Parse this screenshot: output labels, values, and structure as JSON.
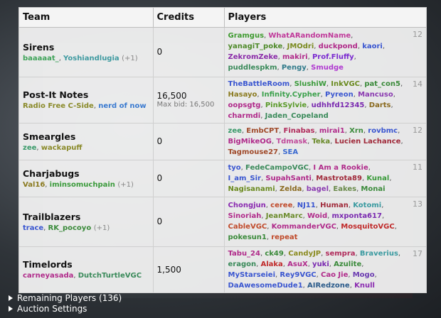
{
  "headers": {
    "team": "Team",
    "credits": "Credits",
    "players": "Players"
  },
  "teams": [
    {
      "name": "Sirens",
      "owners": [
        {
          "n": "baaaaat_",
          "c": "#3fa35a"
        },
        {
          "n": "Yoshiandlugia",
          "c": "#3e9aa0"
        }
      ],
      "extra": "(+1)",
      "credits": "0",
      "maxbid": "",
      "count": "12",
      "players": [
        {
          "n": "Gramgus",
          "c": "#3e9a2f"
        },
        {
          "n": "WhatARandomName",
          "c": "#c0399a"
        },
        {
          "n": "yanagiT_poke",
          "c": "#4f8a2a"
        },
        {
          "n": "JMOdri",
          "c": "#7a8a1f"
        },
        {
          "n": "duckpond",
          "c": "#b02a8a"
        },
        {
          "n": "kaori",
          "c": "#3a56d0"
        },
        {
          "n": "ZekromZeke",
          "c": "#8a2aa8"
        },
        {
          "n": "makiri",
          "c": "#b02a8a"
        },
        {
          "n": "Prof.Fluffy",
          "c": "#7a2ad0"
        },
        {
          "n": "puddlespkm",
          "c": "#3a8a5a"
        },
        {
          "n": "Pengy",
          "c": "#2f7a8a"
        },
        {
          "n": "Smudge",
          "c": "#b03ad0"
        }
      ]
    },
    {
      "name": "Post-It Notes",
      "owners": [
        {
          "n": "Radio Free C-Side",
          "c": "#8a8a2a"
        },
        {
          "n": "nerd of now",
          "c": "#3a7ad0"
        }
      ],
      "extra": "",
      "credits": "16,500",
      "maxbid": "Max bid: 16,500",
      "count": "14",
      "players": [
        {
          "n": "TheBattleRoom",
          "c": "#3a56d0"
        },
        {
          "n": "SlushiW",
          "c": "#3a9a3a"
        },
        {
          "n": "InkVGC",
          "c": "#6a8a1f"
        },
        {
          "n": "pat_con5",
          "c": "#3a8a3a"
        },
        {
          "n": "Hasayo",
          "c": "#8a7a1f"
        },
        {
          "n": "Infinity.Cypher",
          "c": "#3aa04a"
        },
        {
          "n": "Pyreon",
          "c": "#3a56d0"
        },
        {
          "n": "Mancuso",
          "c": "#8a3ab0"
        },
        {
          "n": "oopsgtg",
          "c": "#b02a8a"
        },
        {
          "n": "PinkSylvie",
          "c": "#5a9a2a"
        },
        {
          "n": "udhhfd12345",
          "c": "#7a2ab0"
        },
        {
          "n": "Darts",
          "c": "#8a6a1f"
        },
        {
          "n": "charmdi",
          "c": "#b02a8a"
        },
        {
          "n": "Jaden_Copeland",
          "c": "#3a8a5a"
        }
      ]
    },
    {
      "name": "Smeargles",
      "owners": [
        {
          "n": "zee",
          "c": "#3a9a6a"
        },
        {
          "n": "wackapuff",
          "c": "#8a8a2a"
        }
      ],
      "extra": "",
      "credits": "0",
      "maxbid": "",
      "count": "12",
      "players": [
        {
          "n": "zee",
          "c": "#3a9a6a"
        },
        {
          "n": "EmbCPT",
          "c": "#a04a2a"
        },
        {
          "n": "Finabas",
          "c": "#b02a5a"
        },
        {
          "n": "mirai1",
          "c": "#b02a8a"
        },
        {
          "n": "Xrn",
          "c": "#3a8a3a"
        },
        {
          "n": "rovbmc",
          "c": "#3a56d0"
        },
        {
          "n": "BigMikeOG",
          "c": "#b02a8a"
        },
        {
          "n": "Tdmask",
          "c": "#c04a9a"
        },
        {
          "n": "Teka",
          "c": "#6a8a2a"
        },
        {
          "n": "Lucien Lachance",
          "c": "#a02a3a"
        },
        {
          "n": "Tagmouse27",
          "c": "#a04a2a"
        },
        {
          "n": "SEA",
          "c": "#3a6ad0"
        }
      ]
    },
    {
      "name": "Charjabugs",
      "owners": [
        {
          "n": "Val16",
          "c": "#8a7a1f"
        },
        {
          "n": "iminsomuchpain",
          "c": "#3a9a3a"
        }
      ],
      "extra": "(+1)",
      "credits": "0",
      "maxbid": "",
      "count": "11",
      "players": [
        {
          "n": "tyo",
          "c": "#3a56d0"
        },
        {
          "n": "FedeCampoVGC",
          "c": "#3a8a5a"
        },
        {
          "n": "I Am a Rookie",
          "c": "#b02a8a"
        },
        {
          "n": "I_am_Sir",
          "c": "#3a56d0"
        },
        {
          "n": "SupahSanti",
          "c": "#b02a8a"
        },
        {
          "n": "Mastrota89",
          "c": "#a02a3a"
        },
        {
          "n": "Kunal",
          "c": "#3a9a3a"
        },
        {
          "n": "Nagisanami",
          "c": "#6a8a1f"
        },
        {
          "n": "Zelda",
          "c": "#8a6a1f"
        },
        {
          "n": "bagel",
          "c": "#8a3ab0"
        },
        {
          "n": "Eakes",
          "c": "#6a8a4a"
        },
        {
          "n": "Monai",
          "c": "#3a8a3a"
        }
      ]
    },
    {
      "name": "Trailblazers",
      "owners": [
        {
          "n": "trace",
          "c": "#3a56d0"
        },
        {
          "n": "RK_pocoyo",
          "c": "#3a8a3a"
        }
      ],
      "extra": "(+1)",
      "credits": "0",
      "maxbid": "",
      "count": "13",
      "players": [
        {
          "n": "Chongjun",
          "c": "#8a2ab0"
        },
        {
          "n": "ceree",
          "c": "#c04a2a"
        },
        {
          "n": "NJ11",
          "c": "#3a56d0"
        },
        {
          "n": "Human",
          "c": "#a02a3a"
        },
        {
          "n": "Kotomi",
          "c": "#3a9aa0"
        },
        {
          "n": "Sinoriah",
          "c": "#b02a8a"
        },
        {
          "n": "JeanMarc",
          "c": "#6a8a2a"
        },
        {
          "n": "Woid",
          "c": "#b02a8a"
        },
        {
          "n": "mxponta617",
          "c": "#7a2ab0"
        },
        {
          "n": "CableVGC",
          "c": "#c04a2a"
        },
        {
          "n": "KommanderVGC",
          "c": "#b02a8a"
        },
        {
          "n": "MosquitoVGC",
          "c": "#c02a2a"
        },
        {
          "n": "pokesun1",
          "c": "#3a8a3a"
        },
        {
          "n": "repeat",
          "c": "#c04a2a"
        }
      ]
    },
    {
      "name": "Timelords",
      "owners": [
        {
          "n": "carneyasada",
          "c": "#b02a8a"
        },
        {
          "n": "DutchTurtleVGC",
          "c": "#3a8a5a"
        }
      ],
      "extra": "",
      "credits": "1,500",
      "maxbid": "",
      "count": "17",
      "players": [
        {
          "n": "Tabu_24",
          "c": "#b02a8a"
        },
        {
          "n": "ck49",
          "c": "#3a8a3a"
        },
        {
          "n": "CandyJP",
          "c": "#8a8a1f"
        },
        {
          "n": "sempra",
          "c": "#b02a5a"
        },
        {
          "n": "Braverius",
          "c": "#3a9aa0"
        },
        {
          "n": "eragon",
          "c": "#3a8a5a"
        },
        {
          "n": "Alaka",
          "c": "#c02a2a"
        },
        {
          "n": "AsuX",
          "c": "#b02a8a"
        },
        {
          "n": "yuki",
          "c": "#7a2ab0"
        },
        {
          "n": "Azulite",
          "c": "#3a8a3a"
        },
        {
          "n": "MyStarseiei",
          "c": "#3a56d0"
        },
        {
          "n": "Rey9VGC",
          "c": "#3a56d0"
        },
        {
          "n": "Cao Jie",
          "c": "#b02a8a"
        },
        {
          "n": "Mogo",
          "c": "#6a3ab0"
        },
        {
          "n": "DaAwesomeDude1",
          "c": "#3a56d0"
        },
        {
          "n": "AIRedzone",
          "c": "#2a5a8a"
        },
        {
          "n": "Knull",
          "c": "#8a2ab0"
        }
      ]
    }
  ],
  "footer": {
    "remaining": "Remaining Players (136)",
    "settings": "Auction Settings"
  }
}
